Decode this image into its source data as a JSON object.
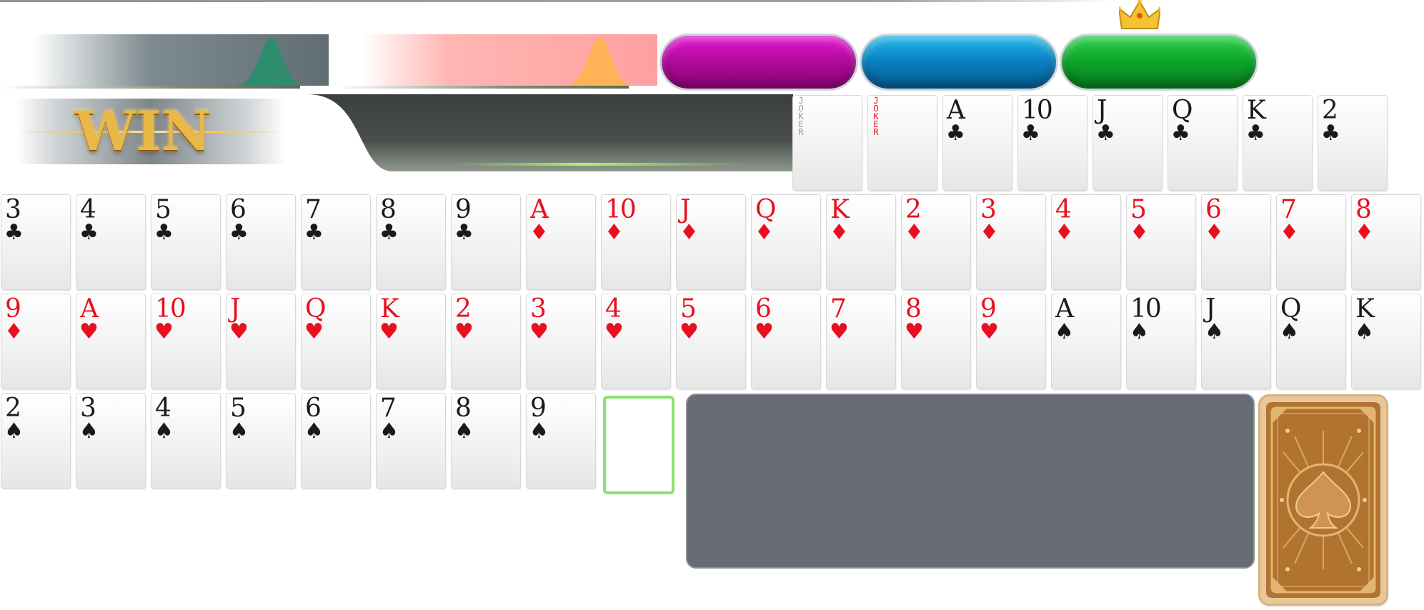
{
  "banner": {
    "win_text": "WIN"
  },
  "progress": {
    "grey_bar": {
      "color": "#606e74"
    },
    "pink_bar": {
      "color": "#ffa0a0"
    }
  },
  "buttons": [
    {
      "name": "magenta",
      "color": "#b40a9c"
    },
    {
      "name": "cyan",
      "color": "#0b84c4"
    },
    {
      "name": "green",
      "color": "#0ea82c",
      "icon": "crown-icon"
    }
  ],
  "hand_row_0": [
    {
      "rank": "JOKER",
      "suit": "",
      "color": "grey"
    },
    {
      "rank": "JOKER",
      "suit": "",
      "color": "red"
    },
    {
      "rank": "A",
      "suit": "♣",
      "color": "black"
    },
    {
      "rank": "10",
      "suit": "♣",
      "color": "black"
    },
    {
      "rank": "J",
      "suit": "♣",
      "color": "black"
    },
    {
      "rank": "Q",
      "suit": "♣",
      "color": "black"
    },
    {
      "rank": "K",
      "suit": "♣",
      "color": "black"
    },
    {
      "rank": "2",
      "suit": "♣",
      "color": "black"
    }
  ],
  "hand_row_1": [
    {
      "rank": "3",
      "suit": "♣",
      "color": "black"
    },
    {
      "rank": "4",
      "suit": "♣",
      "color": "black"
    },
    {
      "rank": "5",
      "suit": "♣",
      "color": "black"
    },
    {
      "rank": "6",
      "suit": "♣",
      "color": "black"
    },
    {
      "rank": "7",
      "suit": "♣",
      "color": "black"
    },
    {
      "rank": "8",
      "suit": "♣",
      "color": "black"
    },
    {
      "rank": "9",
      "suit": "♣",
      "color": "black"
    },
    {
      "rank": "A",
      "suit": "♦",
      "color": "red"
    },
    {
      "rank": "10",
      "suit": "♦",
      "color": "red"
    },
    {
      "rank": "J",
      "suit": "♦",
      "color": "red"
    },
    {
      "rank": "Q",
      "suit": "♦",
      "color": "red"
    },
    {
      "rank": "K",
      "suit": "♦",
      "color": "red"
    },
    {
      "rank": "2",
      "suit": "♦",
      "color": "red"
    },
    {
      "rank": "3",
      "suit": "♦",
      "color": "red"
    },
    {
      "rank": "4",
      "suit": "♦",
      "color": "red"
    },
    {
      "rank": "5",
      "suit": "♦",
      "color": "red"
    },
    {
      "rank": "6",
      "suit": "♦",
      "color": "red"
    },
    {
      "rank": "7",
      "suit": "♦",
      "color": "red"
    },
    {
      "rank": "8",
      "suit": "♦",
      "color": "red"
    }
  ],
  "hand_row_2": [
    {
      "rank": "9",
      "suit": "♦",
      "color": "red"
    },
    {
      "rank": "A",
      "suit": "♥",
      "color": "red"
    },
    {
      "rank": "10",
      "suit": "♥",
      "color": "red"
    },
    {
      "rank": "J",
      "suit": "♥",
      "color": "red"
    },
    {
      "rank": "Q",
      "suit": "♥",
      "color": "red"
    },
    {
      "rank": "K",
      "suit": "♥",
      "color": "red"
    },
    {
      "rank": "2",
      "suit": "♥",
      "color": "red"
    },
    {
      "rank": "3",
      "suit": "♥",
      "color": "red"
    },
    {
      "rank": "4",
      "suit": "♥",
      "color": "red"
    },
    {
      "rank": "5",
      "suit": "♥",
      "color": "red"
    },
    {
      "rank": "6",
      "suit": "♥",
      "color": "red"
    },
    {
      "rank": "7",
      "suit": "♥",
      "color": "red"
    },
    {
      "rank": "8",
      "suit": "♥",
      "color": "red"
    },
    {
      "rank": "9",
      "suit": "♥",
      "color": "red"
    },
    {
      "rank": "A",
      "suit": "♠",
      "color": "black"
    },
    {
      "rank": "10",
      "suit": "♠",
      "color": "black"
    },
    {
      "rank": "J",
      "suit": "♠",
      "color": "black"
    },
    {
      "rank": "Q",
      "suit": "♠",
      "color": "black"
    },
    {
      "rank": "K",
      "suit": "♠",
      "color": "black"
    }
  ],
  "hand_row_3": [
    {
      "rank": "2",
      "suit": "♠",
      "color": "black"
    },
    {
      "rank": "3",
      "suit": "♠",
      "color": "black"
    },
    {
      "rank": "4",
      "suit": "♠",
      "color": "black"
    },
    {
      "rank": "5",
      "suit": "♠",
      "color": "black"
    },
    {
      "rank": "6",
      "suit": "♠",
      "color": "black"
    },
    {
      "rank": "7",
      "suit": "♠",
      "color": "black"
    },
    {
      "rank": "8",
      "suit": "♠",
      "color": "black"
    },
    {
      "rank": "9",
      "suit": "♠",
      "color": "black"
    }
  ],
  "play_area": {
    "slot_color": "#8ee06e",
    "table_color": "#676c74"
  },
  "deck": {
    "icon": "spade-emblem-icon",
    "color": "#b07430"
  }
}
